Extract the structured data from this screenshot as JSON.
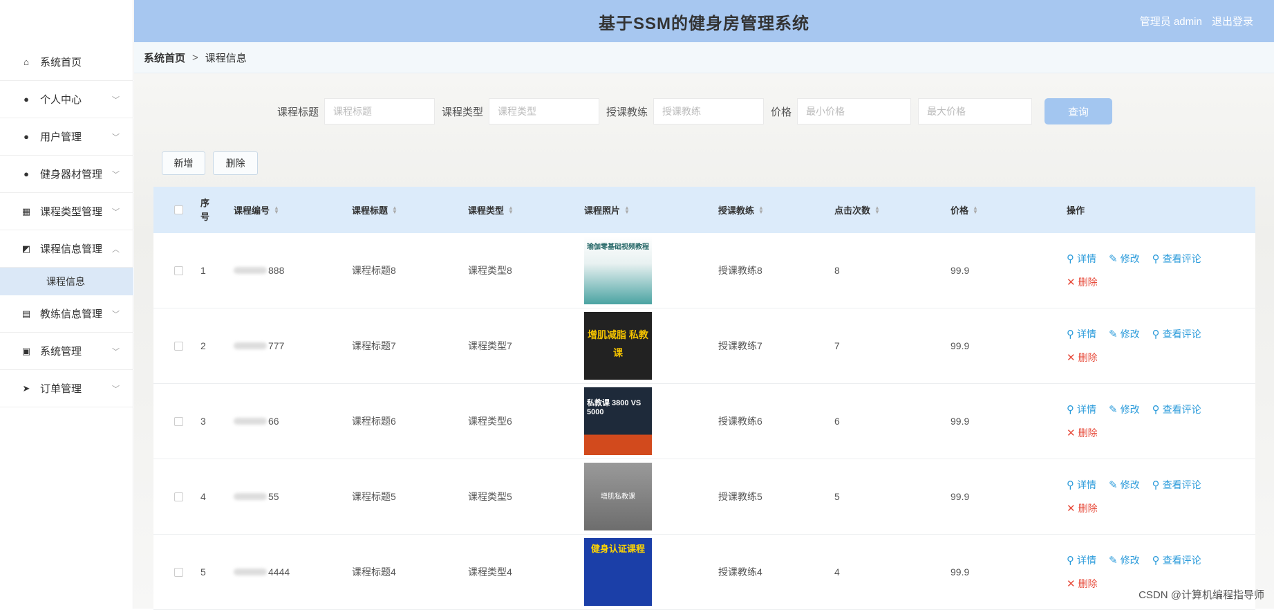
{
  "header": {
    "title": "基于SSM的健身房管理系统",
    "user_label": "管理员 admin",
    "logout": "退出登录"
  },
  "breadcrumb": {
    "home": "系统首页",
    "sep": ">",
    "current": "课程信息"
  },
  "sidebar": {
    "items": [
      {
        "label": "系统首页",
        "icon": "home-icon",
        "glyph": "⌂"
      },
      {
        "label": "个人中心",
        "icon": "user-icon",
        "glyph": "●"
      },
      {
        "label": "用户管理",
        "icon": "user-icon",
        "glyph": "●"
      },
      {
        "label": "健身器材管理",
        "icon": "user-icon",
        "glyph": "●"
      },
      {
        "label": "课程类型管理",
        "icon": "grid-icon",
        "glyph": "▦"
      },
      {
        "label": "课程信息管理",
        "icon": "chart-icon",
        "glyph": "◩"
      },
      {
        "label": "教练信息管理",
        "icon": "clipboard-icon",
        "glyph": "▤"
      },
      {
        "label": "系统管理",
        "icon": "calendar-icon",
        "glyph": "▣"
      },
      {
        "label": "订单管理",
        "icon": "send-icon",
        "glyph": "➤"
      }
    ],
    "sub_item": "课程信息"
  },
  "search": {
    "title_label": "课程标题",
    "title_ph": "课程标题",
    "type_label": "课程类型",
    "type_ph": "课程类型",
    "coach_label": "授课教练",
    "coach_ph": "授课教练",
    "price_label": "价格",
    "min_ph": "最小价格",
    "max_ph": "最大价格",
    "query": "查询"
  },
  "actions": {
    "add": "新增",
    "delete": "删除"
  },
  "table": {
    "headers": {
      "index": "序号",
      "code": "课程编号",
      "title": "课程标题",
      "type": "课程类型",
      "photo": "课程照片",
      "coach": "授课教练",
      "clicks": "点击次数",
      "price": "价格",
      "ops": "操作"
    },
    "op_labels": {
      "detail": "详情",
      "edit": "修改",
      "comments": "查看评论",
      "delete": "删除"
    },
    "rows": [
      {
        "index": "1",
        "code": "888",
        "title": "课程标题8",
        "type": "课程类型8",
        "coach": "授课教练8",
        "clicks": "8",
        "price": "99.9",
        "photo": "瑜伽零基础视频教程"
      },
      {
        "index": "2",
        "code": "777",
        "title": "课程标题7",
        "type": "课程类型7",
        "coach": "授课教练7",
        "clicks": "7",
        "price": "99.9",
        "photo": "增肌减脂 私教课"
      },
      {
        "index": "3",
        "code": "66",
        "title": "课程标题6",
        "type": "课程类型6",
        "coach": "授课教练6",
        "clicks": "6",
        "price": "99.9",
        "photo": "私教课 3800 VS 5000"
      },
      {
        "index": "4",
        "code": "55",
        "title": "课程标题5",
        "type": "课程类型5",
        "coach": "授课教练5",
        "clicks": "5",
        "price": "99.9",
        "photo": "增肌私教课"
      },
      {
        "index": "5",
        "code": "4444",
        "title": "课程标题4",
        "type": "课程类型4",
        "coach": "授课教练4",
        "clicks": "4",
        "price": "99.9",
        "photo": "健身认证课程"
      }
    ]
  },
  "watermark": "CSDN @计算机编程指导师"
}
